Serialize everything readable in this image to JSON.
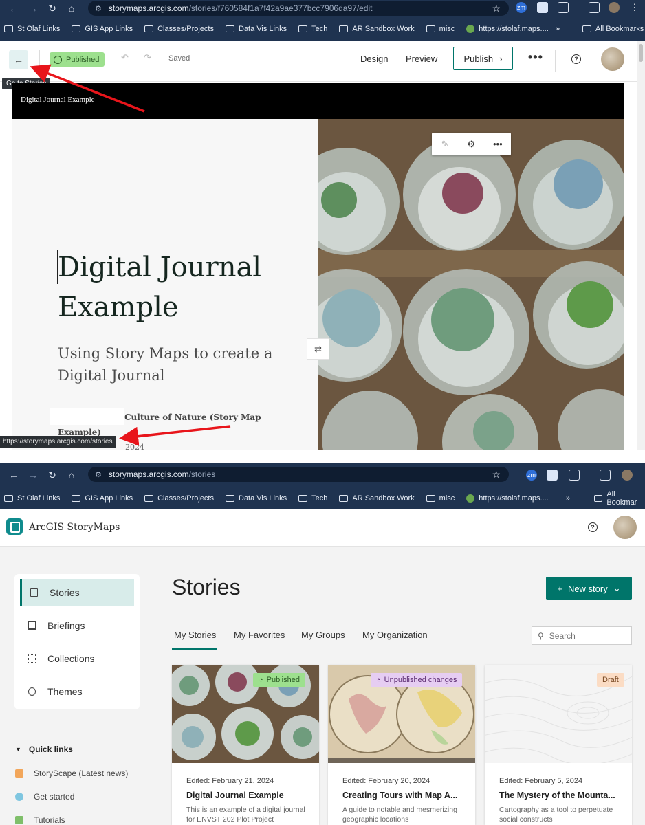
{
  "top_browser": {
    "url_host": "storymaps.arcgis.com",
    "url_path": "/stories/f760584f1a7f42a9ae377bcc7906da97/edit",
    "bookmarks": [
      "St Olaf Links",
      "GIS App Links",
      "Classes/Projects",
      "Data Vis Links",
      "Tech",
      "AR Sandbox Work",
      "misc",
      "https://stolaf.maps...."
    ],
    "all_bookmarks": "All Bookmarks",
    "overflow": "»",
    "zm_label": "zm"
  },
  "editor": {
    "back_glyph": "←",
    "tooltip": "Go to Stories",
    "status_badge": "Published",
    "saved_text": "Saved",
    "design_label": "Design",
    "preview_label": "Preview",
    "publish_label": "Publish",
    "more_glyph": "•••",
    "help_glyph": "?",
    "status_url": "https://storymaps.arcgis.com/stories"
  },
  "story": {
    "header_title": "Digital Journal Example",
    "title_line1": "Digital Journal",
    "title_line2": "Example",
    "subtitle": "Using Story Maps to create a Digital Journal",
    "byline_line1": "Culture of Nature (Story Map",
    "byline_line2": "Example)",
    "date_peek": "2024",
    "swap_glyph": "⇄"
  },
  "bottom_browser": {
    "url_host": "storymaps.arcgis.com",
    "url_path": "/stories",
    "bookmarks": [
      "St Olaf Links",
      "GIS App Links",
      "Classes/Projects",
      "Data Vis Links",
      "Tech",
      "AR Sandbox Work",
      "misc",
      "https://stolaf.maps...."
    ],
    "all_bookmarks": "All Bookmar",
    "overflow": "»",
    "zm_label": "zm"
  },
  "storymaps": {
    "brand": "ArcGIS StoryMaps",
    "page_title": "Stories",
    "new_story_label": "New story",
    "sidebar": [
      {
        "label": "Stories",
        "icon": "document-icon"
      },
      {
        "label": "Briefings",
        "icon": "presentation-icon"
      },
      {
        "label": "Collections",
        "icon": "grid-icon"
      },
      {
        "label": "Themes",
        "icon": "palette-icon"
      }
    ],
    "quick_links_title": "Quick links",
    "quick_links": [
      "StoryScape (Latest news)",
      "Get started",
      "Tutorials"
    ],
    "tabs": [
      "My Stories",
      "My Favorites",
      "My Groups",
      "My Organization"
    ],
    "search_placeholder": "Search",
    "cards": [
      {
        "badge": "Published",
        "edited": "Edited: February 21, 2024",
        "title": "Digital Journal Example",
        "desc": "This is an example of a digital journal for ENVST 202 Plot Project",
        "badge_bg": "#9de08e",
        "badge_fg": "#2a5a24"
      },
      {
        "badge": "Unpublished changes",
        "edited": "Edited: February 20, 2024",
        "title": "Creating Tours with Map A...",
        "desc": "A guide to notable and mesmerizing geographic locations",
        "badge_bg": "#e6cdf2",
        "badge_fg": "#5a2a70"
      },
      {
        "badge": "Draft",
        "edited": "Edited: February 5, 2024",
        "title": "The Mystery of the Mounta...",
        "desc": "Cartography as a tool to perpetuate social constructs",
        "badge_bg": "#fbdcc4",
        "badge_fg": "#7a4a24"
      }
    ]
  },
  "colors": {
    "chrome_bg": "#1f3350",
    "accent_teal": "#00756a",
    "published_green": "#9de08e",
    "annotation_red": "#e8151b"
  }
}
